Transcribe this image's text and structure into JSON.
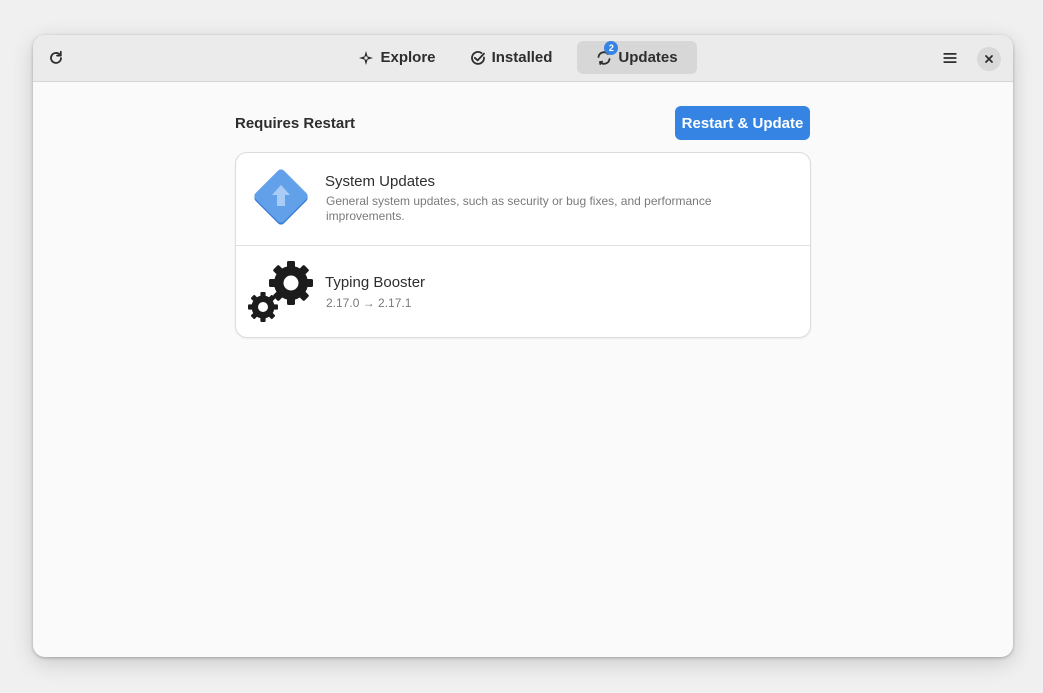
{
  "header": {
    "tabs": [
      {
        "label": "Explore",
        "icon": "explore-icon"
      },
      {
        "label": "Installed",
        "icon": "check-circle-icon"
      },
      {
        "label": "Updates",
        "icon": "refresh-icon",
        "badge": "2",
        "active": true
      }
    ],
    "buttons": {
      "refresh_icon": "refresh-icon",
      "menu_icon": "hamburger-menu-icon",
      "close_icon": "close-icon"
    }
  },
  "main": {
    "section_title": "Requires Restart",
    "action_button": "Restart & Update",
    "updates": [
      {
        "name": "System Updates",
        "description": "General system updates, such as security or bug fixes, and performance improvements.",
        "icon": "system-update-icon"
      },
      {
        "name": "Typing Booster",
        "version": "2.17.0 → 2.17.1",
        "icon": "gears-icon"
      }
    ]
  },
  "colors": {
    "accent": "#3584e4",
    "active_tab": "#d7d7d7",
    "headerbar": "#ebebeb"
  }
}
